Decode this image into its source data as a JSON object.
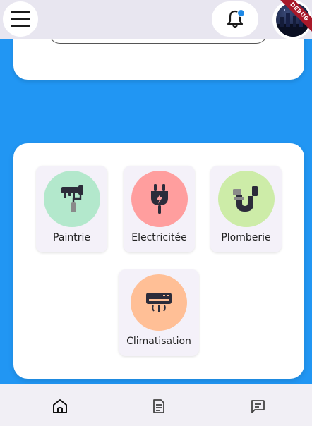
{
  "header": {
    "debug_badge": "DEBUG",
    "icons": {
      "menu": "hamburger-menu-icon",
      "notifications": "bell-icon",
      "avatar": "profile-avatar"
    }
  },
  "services": [
    {
      "label": "Paintrie",
      "icon": "paint-roller-icon",
      "color": "#b3e8cc"
    },
    {
      "label": "Electricitée",
      "icon": "plug-icon",
      "color": "#ff9e9e"
    },
    {
      "label": "Plomberie",
      "icon": "pipe-icon",
      "color": "#cdeca8"
    },
    {
      "label": "Climatisation",
      "icon": "air-conditioner-icon",
      "color": "#ffbf96"
    }
  ],
  "bottom_nav": [
    {
      "name": "home",
      "icon": "home-icon",
      "active": true
    },
    {
      "name": "documents",
      "icon": "document-icon",
      "active": false
    },
    {
      "name": "messages",
      "icon": "chat-icon",
      "active": false
    }
  ],
  "colors": {
    "background": "#2196f3",
    "top_bar": "#e8e6f0",
    "bottom_bar": "#f1eff5",
    "card": "#ffffff",
    "tile": "#f4f1f9"
  }
}
